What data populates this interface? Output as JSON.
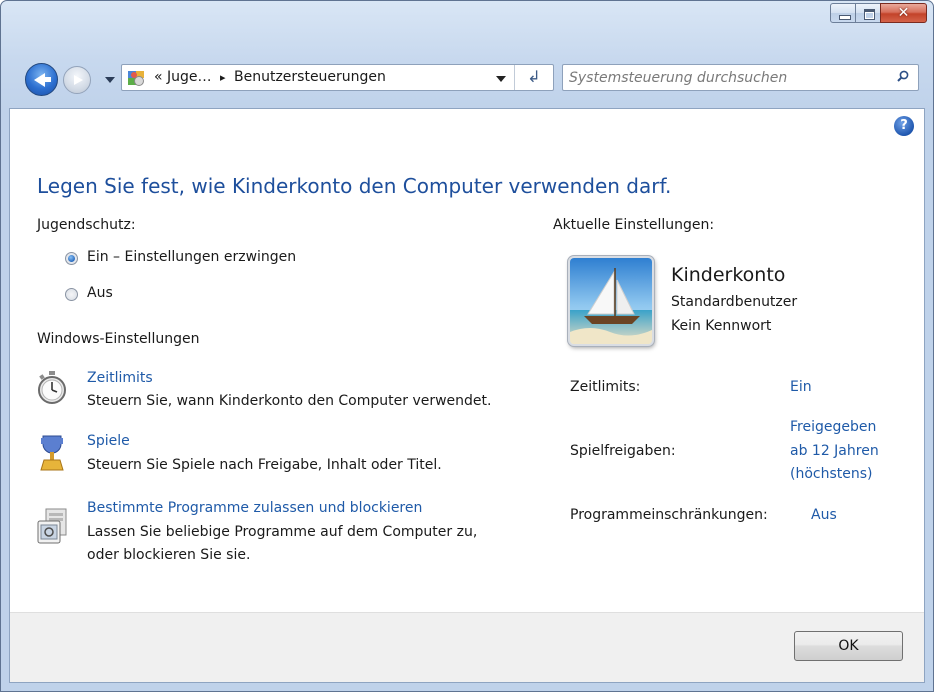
{
  "window": {
    "caption_buttons": {
      "minimize": "minimize-icon",
      "maximize": "maximize-icon",
      "close": "close-icon"
    }
  },
  "nav": {
    "back_icon": "back-arrow-icon",
    "forward_icon": "forward-arrow-icon",
    "breadcrumb_prefix": "«",
    "breadcrumb_parent": "Juge…",
    "breadcrumb_separator": "▸",
    "breadcrumb_current": "Benutzersteuerungen",
    "refresh_icon": "refresh-icon",
    "search_placeholder": "Systemsteuerung durchsuchen"
  },
  "main": {
    "title": "Legen Sie fest, wie Kinderkonto den Computer verwenden darf.",
    "parental_controls_label": "Jugendschutz:",
    "radio_on_label": "Ein – Einstellungen erzwingen",
    "radio_off_label": "Aus",
    "radio_selected": "on",
    "windows_settings_label": "Windows-Einstellungen",
    "items": [
      {
        "icon": "stopwatch-icon",
        "link": "Zeitlimits",
        "description": "Steuern Sie, wann Kinderkonto den Computer verwendet."
      },
      {
        "icon": "trophy-icon",
        "link": "Spiele",
        "description": "Steuern Sie Spiele nach Freigabe, Inhalt oder Titel."
      },
      {
        "icon": "program-block-icon",
        "link": "Bestimmte Programme zulassen und blockieren",
        "description_line1": "Lassen Sie beliebige Programme auf dem Computer zu,",
        "description_line2": "oder blockieren Sie sie."
      }
    ]
  },
  "current_settings": {
    "heading": "Aktuelle Einstellungen:",
    "account_name": "Kinderkonto",
    "account_type": "Standardbenutzer",
    "password_status": "Kein Kennwort",
    "time_limits_label": "Zeitlimits:",
    "time_limits_value": "Ein",
    "game_ratings_label": "Spielfreigaben:",
    "game_ratings_line1": "Freigegeben",
    "game_ratings_line2": "ab 12 Jahren",
    "game_ratings_line3": "(höchstens)",
    "program_restrictions_label": "Programmeinschränkungen:",
    "program_restrictions_value": "Aus"
  },
  "footer": {
    "ok_label": "OK"
  },
  "colors": {
    "link": "#1f5aa8",
    "title": "#1e4f9c",
    "window_frame": "#c7d8ee",
    "close_button": "#c3432a"
  }
}
